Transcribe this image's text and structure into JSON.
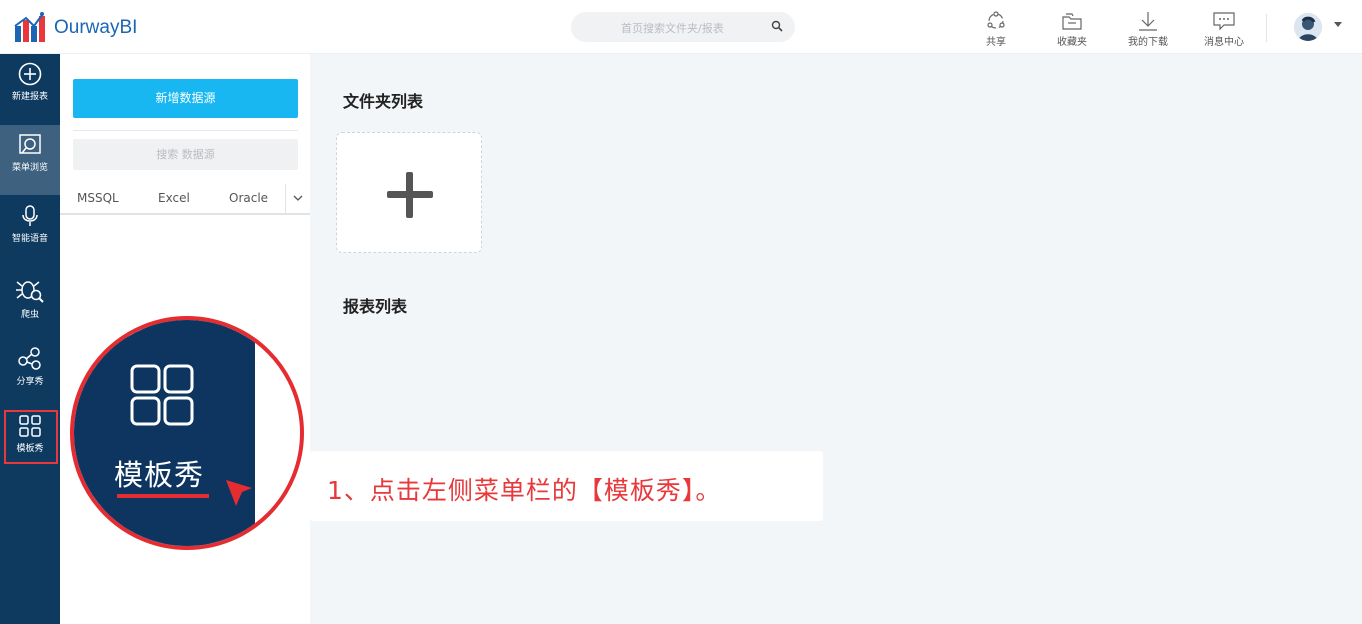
{
  "app": {
    "name": "OurwayBI"
  },
  "search": {
    "placeholder": "首页搜索文件夹/报表"
  },
  "toolbar": [
    {
      "label": "共享",
      "icon": "share-icon"
    },
    {
      "label": "收藏夹",
      "icon": "folder-favorite-icon"
    },
    {
      "label": "我的下载",
      "icon": "download-icon"
    },
    {
      "label": "消息中心",
      "icon": "message-icon"
    }
  ],
  "leftnav": [
    {
      "label": "新建报表",
      "icon": "plus-circle-icon",
      "active": false
    },
    {
      "label": "菜单浏览",
      "icon": "menu-browse-icon",
      "active": true
    },
    {
      "label": "智能语音",
      "icon": "microphone-icon",
      "active": false
    },
    {
      "label": "爬虫",
      "icon": "spider-icon",
      "active": false
    },
    {
      "label": "分享秀",
      "icon": "share-nodes-icon",
      "active": false
    },
    {
      "label": "模板秀",
      "icon": "grid-icon",
      "active": false,
      "highlighted": true
    }
  ],
  "panel": {
    "new_button": "新增数据源",
    "search_placeholder": "搜索 数据源",
    "tabs": [
      "MSSQL",
      "Excel",
      "Oracle"
    ]
  },
  "main": {
    "folder_list_title": "文件夹列表",
    "report_list_title": "报表列表"
  },
  "zoom": {
    "label": "模板秀"
  },
  "callout": {
    "text": "1、点击左侧菜单栏的【模板秀】。"
  },
  "colors": {
    "nav_bg": "#0e3a60",
    "nav_active": "#3d617f",
    "primary_button": "#18b7f2",
    "highlight_red": "#e52d31",
    "brand_blue": "#1a66b5"
  }
}
